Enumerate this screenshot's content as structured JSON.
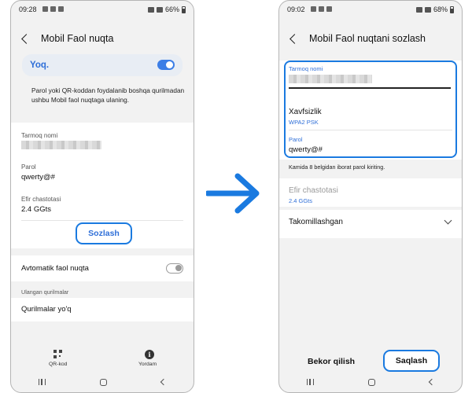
{
  "left_screen": {
    "status": {
      "time": "09:28",
      "battery": "66%"
    },
    "header": {
      "title": "Mobil Faol nuqta"
    },
    "hotspot_toggle": {
      "label": "Yoq.",
      "state": "on"
    },
    "description": "Parol yoki QR-koddan foydalanib boshqa qurilmadan ushbu Mobil faol nuqtaga ulaning.",
    "network_name": {
      "label": "Tarmoq nomi"
    },
    "password": {
      "label": "Parol",
      "value": "qwerty@#"
    },
    "band": {
      "label": "Efir chastotasi",
      "value": "2.4 GGts"
    },
    "configure_button": "Sozlash",
    "auto_hotspot": {
      "label": "Avtomatik faol nuqta",
      "state": "off"
    },
    "connected_devices": {
      "section_label": "Ulangan qurilmalar",
      "empty_text": "Qurilmalar yo'q"
    },
    "bottom_actions": {
      "qr_label": "QR-kod",
      "help_label": "Yordam"
    }
  },
  "right_screen": {
    "status": {
      "time": "09:02",
      "battery": "68%"
    },
    "header": {
      "title": "Mobil Faol nuqtani sozlash"
    },
    "network_name": {
      "label": "Tarmoq nomi"
    },
    "security": {
      "label": "Xavfsizlik",
      "value": "WPA2 PSK"
    },
    "password": {
      "label": "Parol",
      "value": "qwerty@#",
      "hint": "Kamida 8 belgidan iborat parol kiriting."
    },
    "band": {
      "label": "Efir chastotasi",
      "value": "2.4 GGts"
    },
    "advanced": {
      "label": "Takomillashgan"
    },
    "cancel_button": "Bekor qilish",
    "save_button": "Saqlash"
  },
  "colors": {
    "accent": "#1a7ae0",
    "link_blue": "#2f6fd8",
    "toggle_on": "#3c7ee6"
  },
  "icons": [
    "back-icon",
    "qr-code-icon",
    "info-icon",
    "chevron-down-icon",
    "right-arrow-icon",
    "recents-icon",
    "home-icon",
    "nav-back-icon"
  ]
}
